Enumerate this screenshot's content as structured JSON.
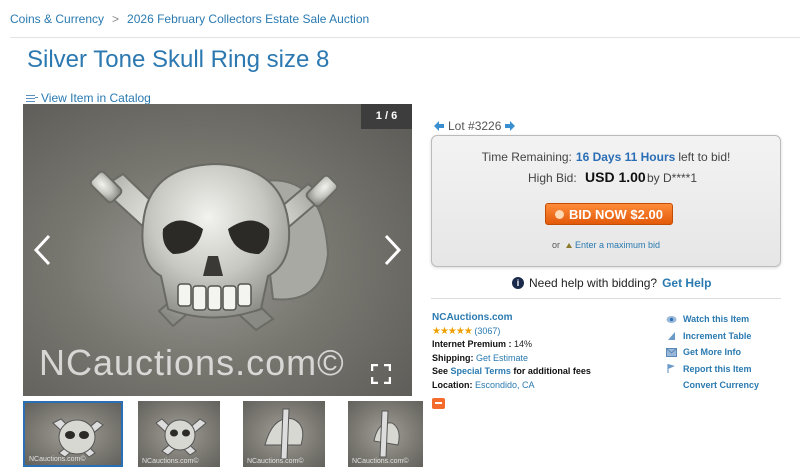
{
  "breadcrumb": {
    "items": [
      "Coins & Currency",
      "2026 February Collectors Estate Sale Auction"
    ],
    "separator": ">"
  },
  "page_title": "Silver Tone Skull Ring size 8",
  "catalog_link": "View Item in Catalog",
  "gallery": {
    "counter": "1 / 6",
    "watermark": "NCauctions.com©",
    "thumb_watermark": "NCauctions.com©",
    "thumb_count": 4,
    "active_index": 0
  },
  "lot": {
    "label": "Lot #3226"
  },
  "bid_box": {
    "time_label": "Time Remaining:",
    "time_value": "16 Days 11 Hours",
    "time_tail": "left to bid!",
    "high_bid_label": "High Bid:",
    "high_bid_value": "USD 1.00",
    "high_bid_by": "by D****1",
    "bid_button": "BID NOW $2.00",
    "or_text": "or",
    "max_bid_link": "Enter a maximum bid"
  },
  "help": {
    "text": "Need help with bidding?",
    "link": "Get Help"
  },
  "seller": {
    "name": "NCAuctions.com",
    "stars": "★★★★★",
    "rating": 5,
    "reviews": "(3067)",
    "premium_label": "Internet Premium :",
    "premium_value": "14%",
    "shipping_label": "Shipping:",
    "shipping_link": "Get Estimate",
    "see_text": "See",
    "special_terms_link": "Special Terms",
    "fees_text": "for additional fees",
    "location_label": "Location:",
    "location_value": "Escondido, CA"
  },
  "actions": {
    "watch": "Watch this Item",
    "increment": "Increment Table",
    "more_info": "Get More Info",
    "report": "Report this Item",
    "currency": "Convert Currency"
  },
  "colors": {
    "link": "#2a7ab0",
    "accent_orange": "#f26a1b",
    "star": "#f0a000"
  }
}
